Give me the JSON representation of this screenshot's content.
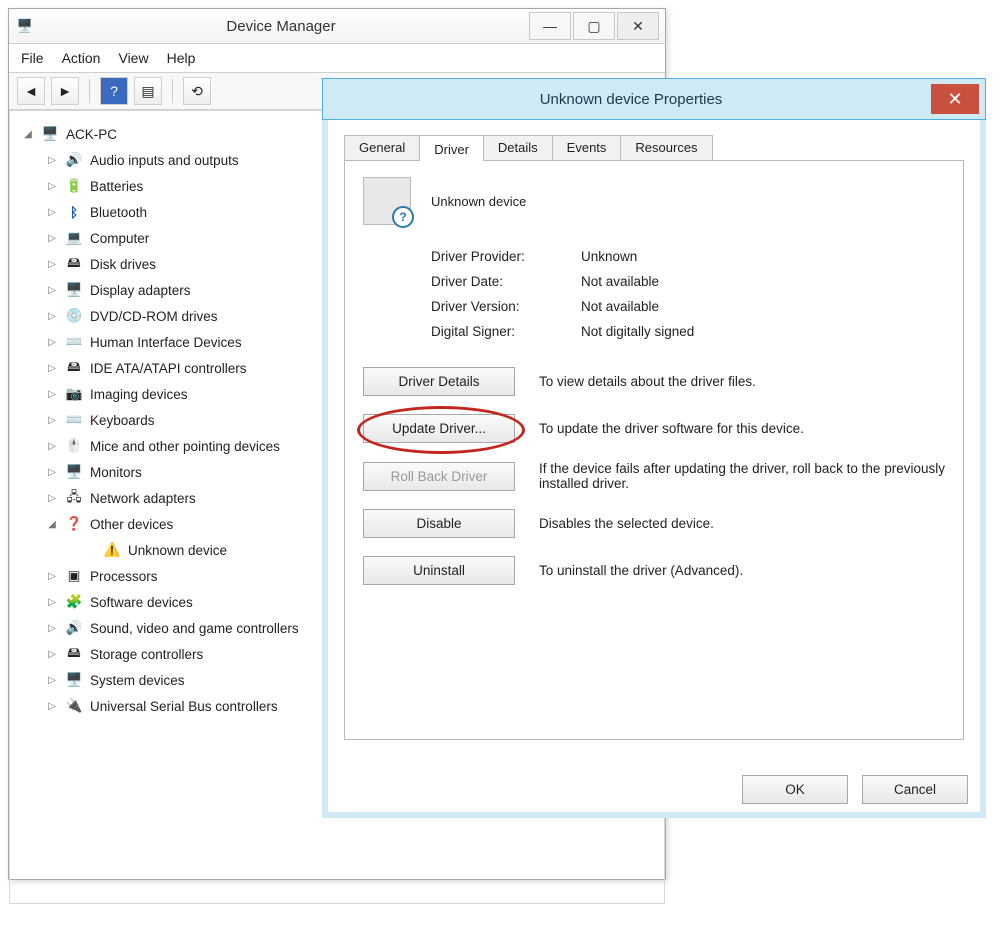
{
  "dm": {
    "title": "Device Manager",
    "menu": {
      "file": "File",
      "action": "Action",
      "view": "View",
      "help": "Help"
    },
    "winbtn": {
      "min": "—",
      "max": "▢",
      "close": "✕"
    },
    "root": "ACK-PC",
    "nodes": {
      "audio": "Audio inputs and outputs",
      "batt": "Batteries",
      "bt": "Bluetooth",
      "comp": "Computer",
      "disk": "Disk drives",
      "disp": "Display adapters",
      "dvd": "DVD/CD-ROM drives",
      "hid": "Human Interface Devices",
      "ide": "IDE ATA/ATAPI controllers",
      "imaging": "Imaging devices",
      "keyb": "Keyboards",
      "mice": "Mice and other pointing devices",
      "mon": "Monitors",
      "net": "Network adapters",
      "other": "Other devices",
      "unknown": "Unknown device",
      "proc": "Processors",
      "swdev": "Software devices",
      "sound": "Sound, video and game controllers",
      "storage": "Storage controllers",
      "sys": "System devices",
      "usb": "Universal Serial Bus controllers"
    }
  },
  "props": {
    "title": "Unknown device Properties",
    "close": "✕",
    "tabs": {
      "general": "General",
      "driver": "Driver",
      "details": "Details",
      "events": "Events",
      "resources": "Resources"
    },
    "device_name": "Unknown device",
    "info": {
      "provider_label": "Driver Provider:",
      "provider_value": "Unknown",
      "date_label": "Driver Date:",
      "date_value": "Not available",
      "version_label": "Driver Version:",
      "version_value": "Not available",
      "signer_label": "Digital Signer:",
      "signer_value": "Not digitally signed"
    },
    "actions": {
      "details_btn": "Driver Details",
      "details_txt": "To view details about the driver files.",
      "update_btn": "Update Driver...",
      "update_txt": "To update the driver software for this device.",
      "rollback_btn": "Roll Back Driver",
      "rollback_txt": "If the device fails after updating the driver, roll back to the previously installed driver.",
      "disable_btn": "Disable",
      "disable_txt": "Disables the selected device.",
      "uninstall_btn": "Uninstall",
      "uninstall_txt": "To uninstall the driver (Advanced)."
    },
    "buttons": {
      "ok": "OK",
      "cancel": "Cancel"
    }
  }
}
